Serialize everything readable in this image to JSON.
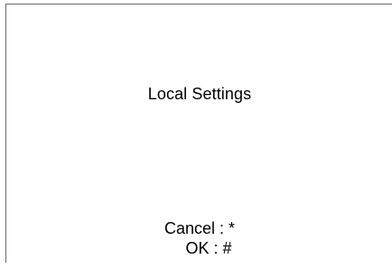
{
  "screen": {
    "title": "Local Settings",
    "cancel_hint": "Cancel : *",
    "ok_hint": "OK : #"
  }
}
